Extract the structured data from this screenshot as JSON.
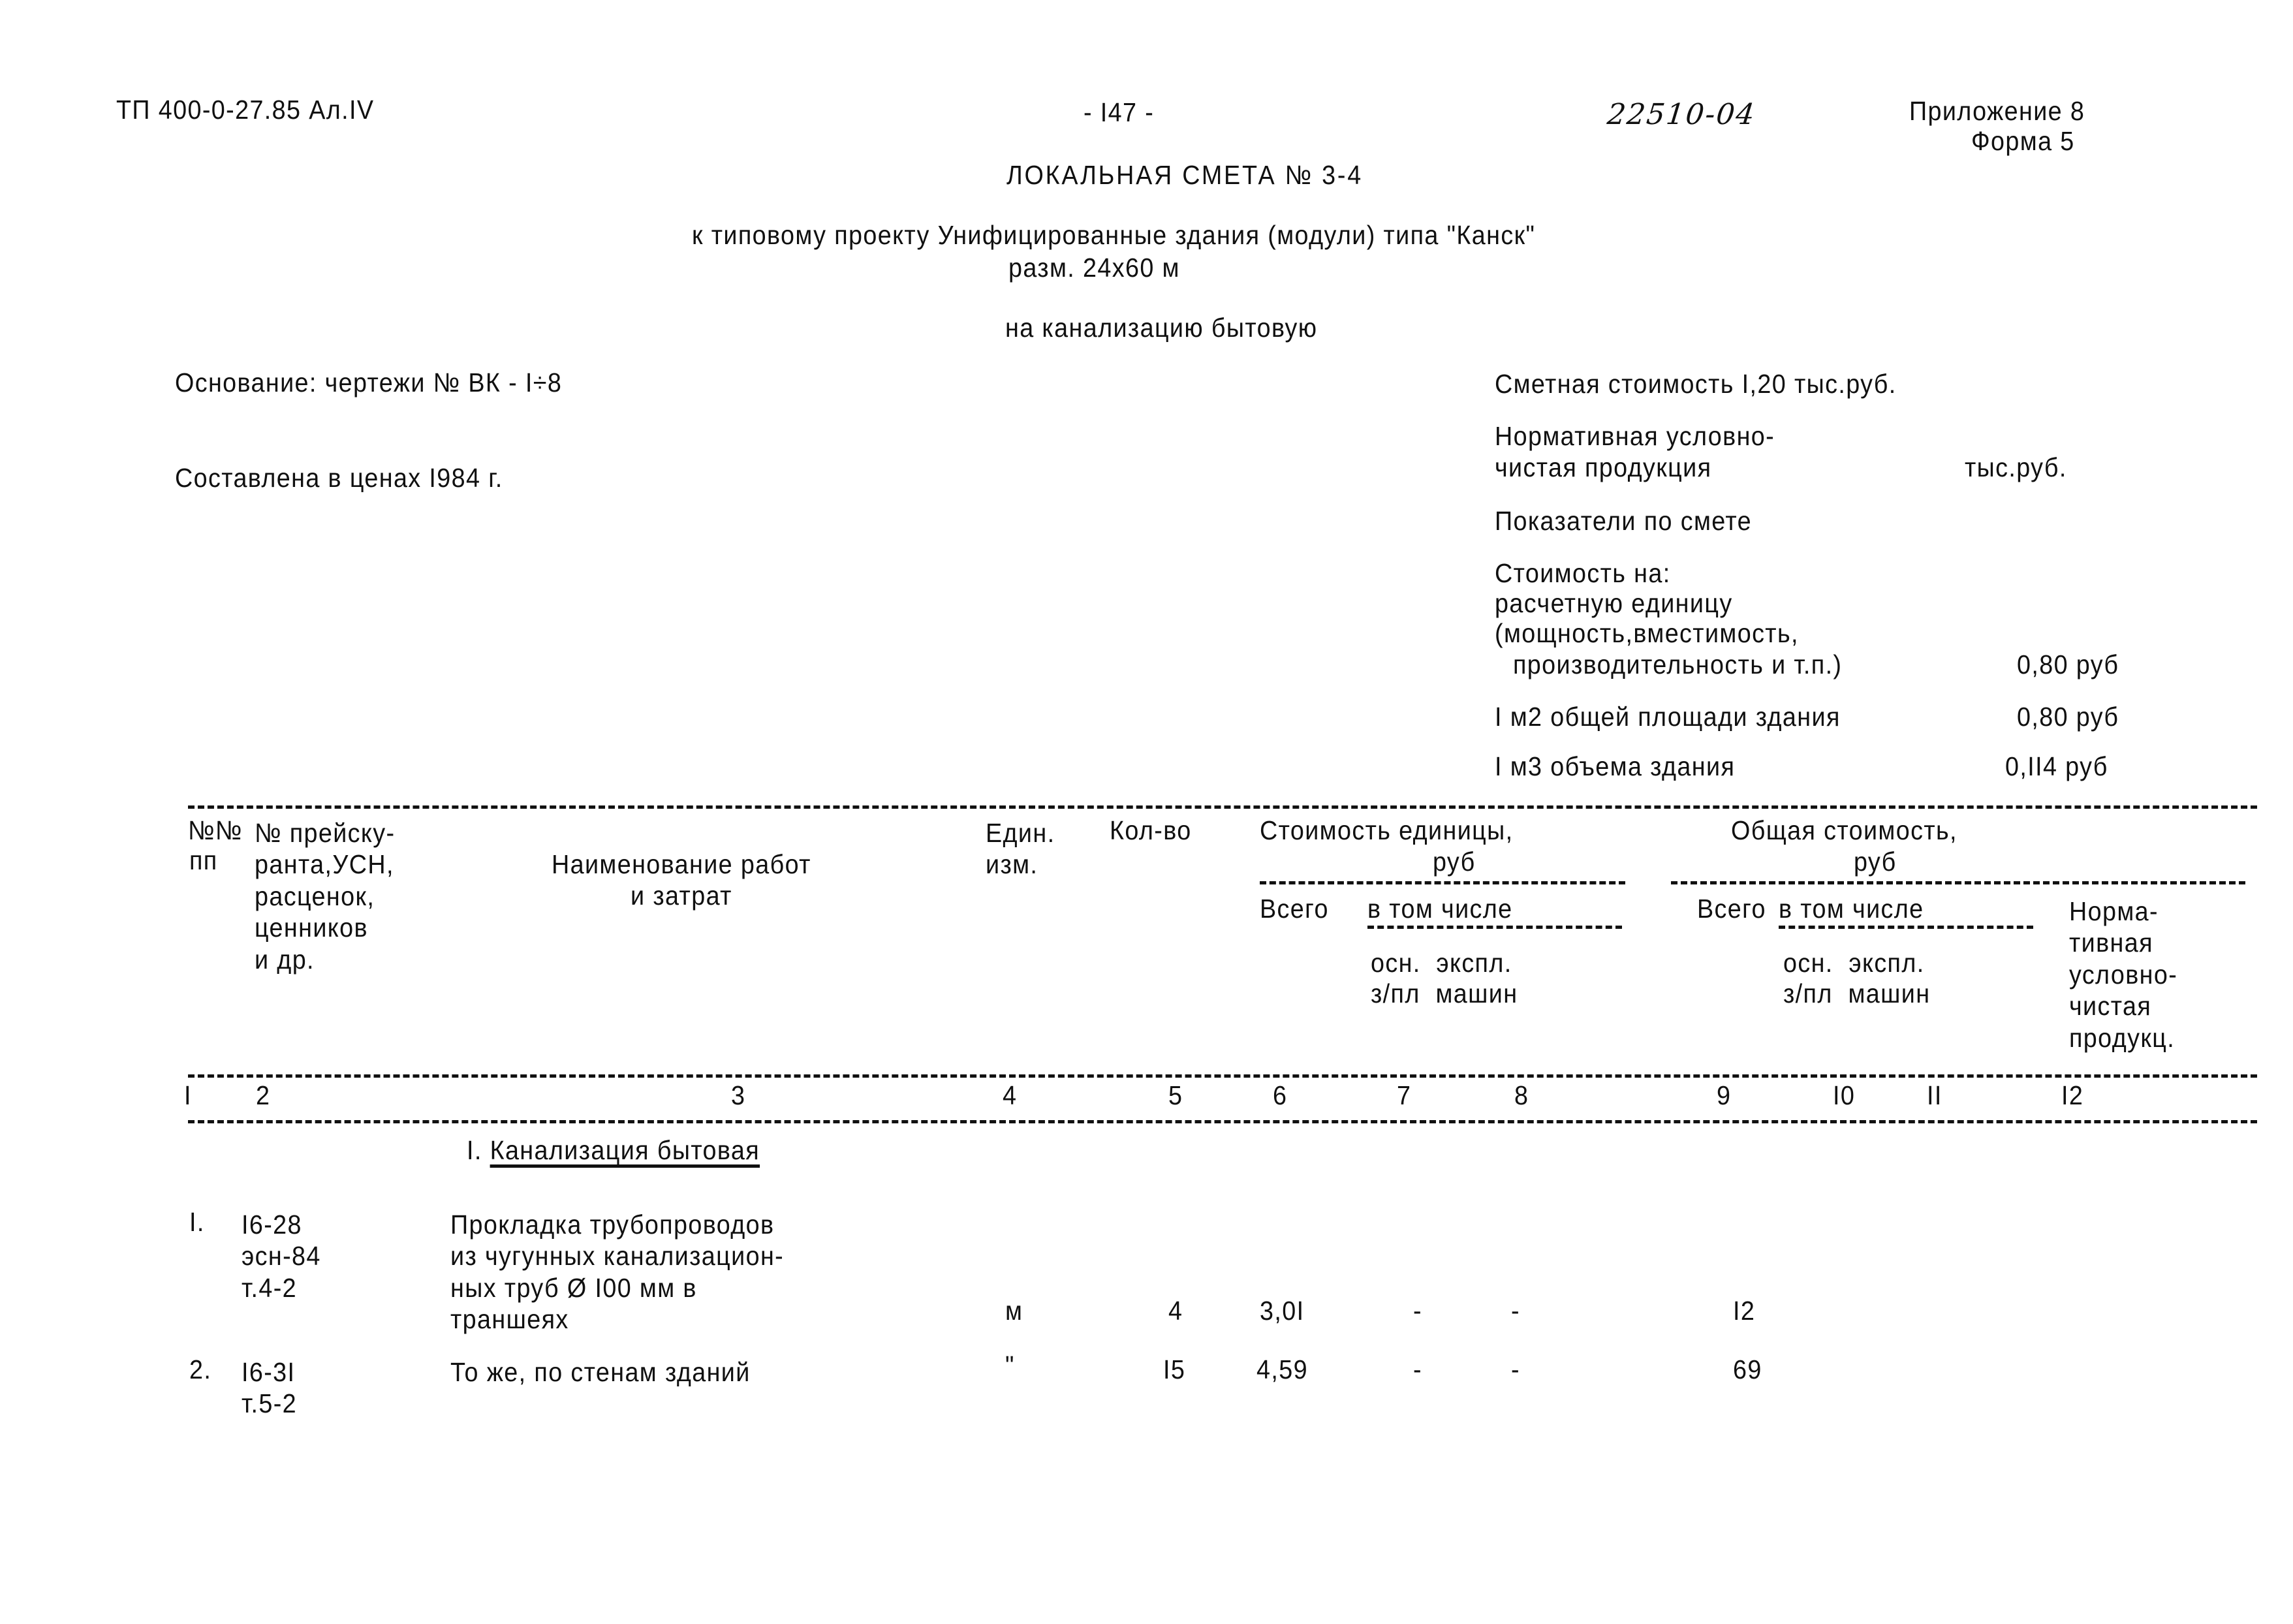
{
  "header": {
    "doc_code": "ТП 400-0-27.85 Ал.IV",
    "page_number": "- I47 -",
    "drawing_number": "22510-04",
    "appendix_no": "Приложение 8",
    "form_no": "Форма 5"
  },
  "title": {
    "smeta_title": "ЛОКАЛЬНАЯ СМЕТА № 3-4",
    "project_line_1": "к типовому проекту Унифицированные здания (модули) типа \"Канск\"",
    "project_line_2": "разм. 24х60 м",
    "object_line": "на канализацию бытовую"
  },
  "basis": {
    "basis_line": "Основание: чертежи № ВК - I÷8",
    "prices_line": "Составлена в ценах I984 г."
  },
  "cost_block": {
    "cost_total": "Сметная стоимость I,20 тыс.руб.",
    "nucp_1": "Нормативная условно-",
    "nucp_2": "чистая продукция",
    "nucp_units": "тыс.руб.",
    "indicators_title": "Показатели по смете",
    "cost_for": "Стоимость на:",
    "unit_line_1": "расчетную единицу",
    "unit_line_2": "(мощность,вместимость,",
    "unit_line_3": "производительность и т.п.)",
    "unit_value": "0,80 руб",
    "area_line": "I м2 общей площади здания",
    "area_value": "0,80 руб",
    "volume_line": "I м3 объема здания",
    "volume_value": "0,II4 руб"
  },
  "table": {
    "headers": {
      "num_1": "№№",
      "num_2": "пп",
      "col2": "№ прейску-\nранта,УСН,\nрасценок,\nценников\nи др.",
      "col3": "Наименование работ\nи затрат",
      "col4": "Един.\nизм.",
      "col5": "Кол-во",
      "unit_cost": "Стоимость единицы,",
      "unit_cost_rub": "руб",
      "unit_vsego": "Всего",
      "unit_vtom": "в том числе",
      "unit_osn": "осн.  экспл.",
      "unit_zpl": "з/пл  машин",
      "total_cost": "Общая стоимость,",
      "total_cost_rub": "руб",
      "total_vsego": "Всего",
      "total_vtom": "в том числе",
      "total_osn": "осн.  экспл.",
      "total_zpl": "з/пл  машин",
      "col12": "Норма-\nтивная\nусловно-\nчистая\nпродукц."
    },
    "column_numbers": [
      "I",
      "2",
      "3",
      "4",
      "5",
      "6",
      "7",
      "8",
      "9",
      "I0",
      "II",
      "I2"
    ],
    "section_heading_prefix": "I. ",
    "section_heading_text": "Канализация бытовая",
    "rows": [
      {
        "no": "I.",
        "code": "I6-28\nэсн-84\nт.4-2",
        "name": "Прокладка трубопроводов\nиз чугунных канализацион-\nных труб Ø I00 мм в\nтраншеях",
        "unit": "м",
        "qty": "4",
        "price": "3,0I",
        "c7": "-",
        "c8": "-",
        "c9": "I2"
      },
      {
        "no": "2.",
        "code": "I6-3I\nт.5-2",
        "name": "То же, по стенам зданий",
        "unit": "\"",
        "qty": "I5",
        "price": "4,59",
        "c7": "-",
        "c8": "-",
        "c9": "69"
      }
    ]
  }
}
